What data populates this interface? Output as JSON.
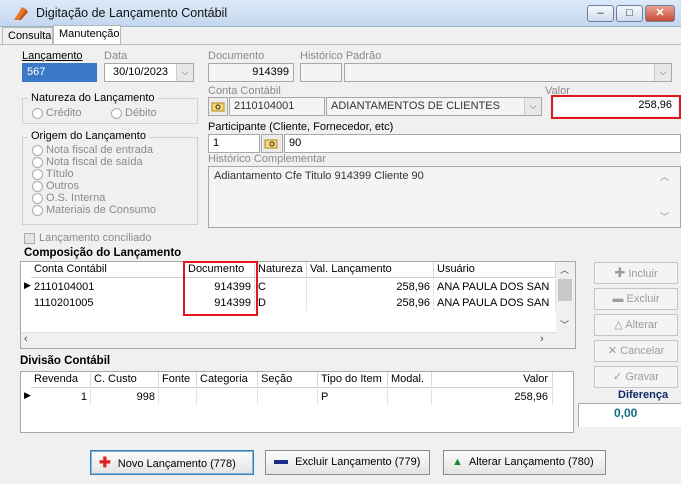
{
  "window": {
    "title": "Digitação de Lançamento Contábil",
    "min": "–",
    "max": "□",
    "close": "✕"
  },
  "tabs": [
    {
      "label": "Consulta"
    },
    {
      "label": "Manutenção"
    }
  ],
  "header": {
    "lancamento_label": "Lançamento",
    "lancamento_value": "567",
    "data_label": "Data",
    "data_value": "30/10/2023",
    "documento_label": "Documento",
    "documento_value": "914399",
    "historico_padrao_label": "Histórico Padrão",
    "historico_padrao_value": ""
  },
  "natureza": {
    "label": "Natureza do Lançamento",
    "credito": "Crédito",
    "debito": "Débito"
  },
  "conta_contabil": {
    "label": "Conta Contábil",
    "code": "2110104001",
    "name": "ADIANTAMENTOS DE CLIENTES"
  },
  "valor": {
    "label": "Valor",
    "value": "258,96"
  },
  "participante": {
    "label": "Participante (Cliente, Fornecedor, etc)",
    "tipo": "1",
    "codigo": "90"
  },
  "origem": {
    "label": "Origem do Lançamento",
    "options": [
      "Nota fiscal de entrada",
      "Nota fiscal de saída",
      "Título",
      "Outros",
      "O.S. Interna",
      "Materiais de Consumo"
    ]
  },
  "historico_complementar": {
    "label": "Histórico Complementar",
    "value": "Adiantamento Cfe Titulo 914399 Cliente 90"
  },
  "conciliado": {
    "label": "Lançamento conciliado"
  },
  "composicao": {
    "title": "Composição do Lançamento",
    "columns": [
      "Conta Contábil",
      "Documento",
      "Natureza",
      "Val. Lançamento",
      "Usuário"
    ],
    "rows": [
      {
        "conta": "2110104001",
        "documento": "914399",
        "natureza": "C",
        "valor": "258,96",
        "usuario": "ANA PAULA DOS SAN"
      },
      {
        "conta": "1110201005",
        "documento": "914399",
        "natureza": "D",
        "valor": "258,96",
        "usuario": "ANA PAULA DOS SAN"
      }
    ]
  },
  "divisao": {
    "title": "Divisão Contábil",
    "columns": [
      "Revenda",
      "C. Custo",
      "Fonte",
      "Categoria",
      "Seção",
      "Tipo do Item",
      "Modal.",
      "Valor"
    ],
    "rows": [
      {
        "revenda": "1",
        "ccusto": "998",
        "fonte": "",
        "categoria": "",
        "secao": "",
        "tipo": "P",
        "modal": "",
        "valor": "258,96"
      }
    ]
  },
  "side_buttons": {
    "incluir": "Incluir",
    "excluir": "Excluir",
    "alterar": "Alterar",
    "cancelar": "Cancelar",
    "gravar": "Gravar"
  },
  "diferenca": {
    "label": "Diferença",
    "value": "0,00"
  },
  "bottom_buttons": {
    "novo": "Novo Lançamento (778)",
    "excluir": "Excluir Lançamento (779)",
    "alterar": "Alterar Lançamento (780)"
  },
  "colors": {
    "highlight": "#e0171f",
    "selection": "#3a78c8",
    "diferenca": "#0d6e8a"
  }
}
